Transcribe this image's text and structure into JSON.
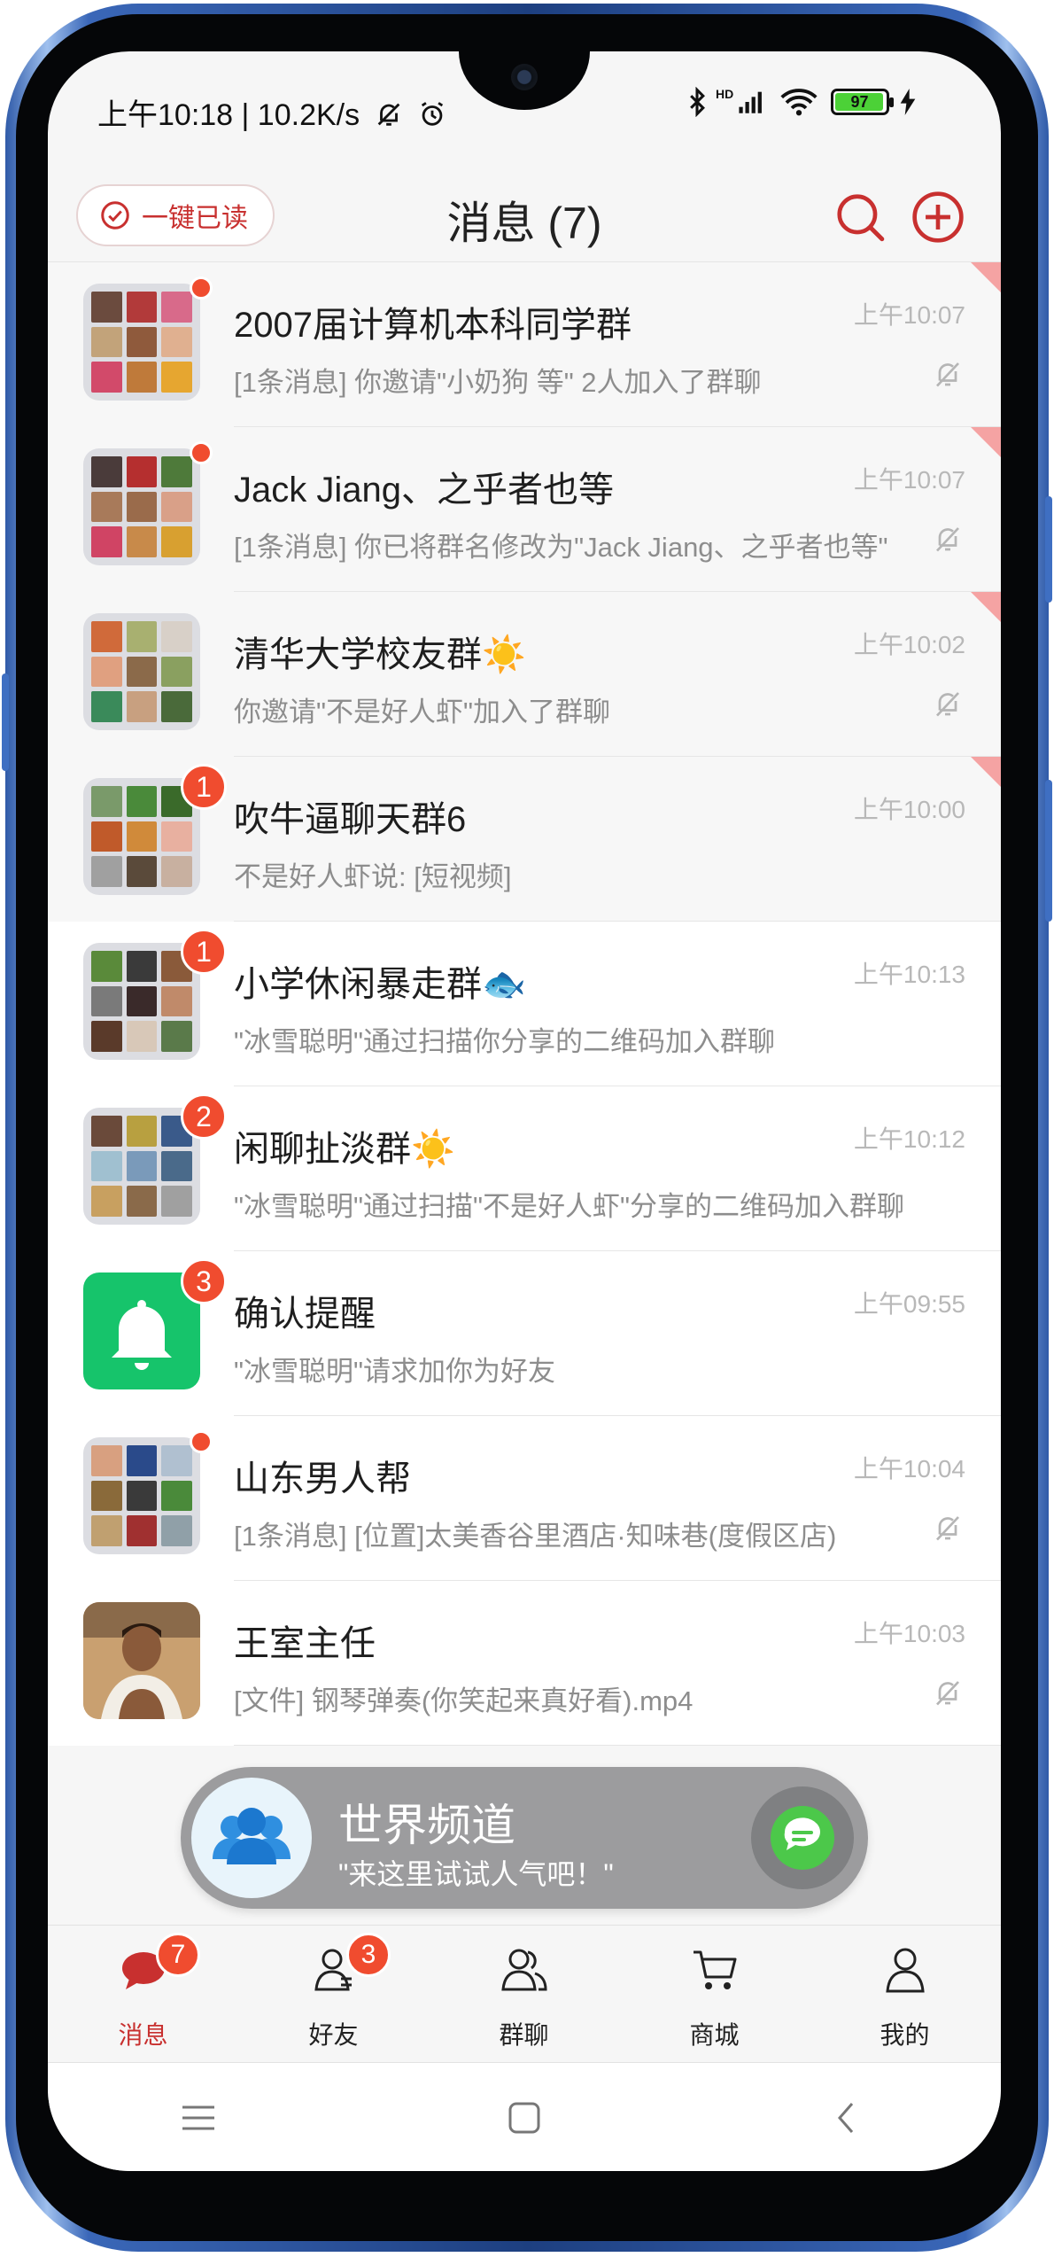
{
  "status_bar": {
    "time_text": "上午10:18 | 10.2K/s",
    "battery_level": 97,
    "battery_text": "97",
    "hd_text": "HD"
  },
  "header": {
    "mark_all_read": "一键已读",
    "title": "消息 (7)"
  },
  "conversations": [
    {
      "name": "2007届计算机本科同学群",
      "time": "上午10:07",
      "preview": "[1条消息] 你邀请\"小奶狗 等\" 2人加入了群聊",
      "pinned": true,
      "muted": true,
      "indicator": "dot",
      "badge": "",
      "avatar": "group"
    },
    {
      "name": "Jack Jiang、之乎者也等",
      "time": "上午10:07",
      "preview": "[1条消息] 你已将群名修改为\"Jack Jiang、之乎者也等\"",
      "pinned": true,
      "muted": true,
      "indicator": "dot",
      "badge": "",
      "avatar": "group"
    },
    {
      "name": "清华大学校友群☀️",
      "time": "上午10:02",
      "preview": "你邀请\"不是好人虾\"加入了群聊",
      "pinned": true,
      "muted": true,
      "indicator": "none",
      "badge": "",
      "avatar": "group"
    },
    {
      "name": "吹牛逼聊天群6",
      "time": "上午10:00",
      "preview": "不是好人虾说: [短视频]",
      "pinned": true,
      "muted": false,
      "indicator": "badge",
      "badge": "1",
      "avatar": "group"
    },
    {
      "name": "小学休闲暴走群🐟",
      "time": "上午10:13",
      "preview": "\"冰雪聪明\"通过扫描你分享的二维码加入群聊",
      "pinned": false,
      "muted": false,
      "indicator": "badge",
      "badge": "1",
      "avatar": "group"
    },
    {
      "name": "闲聊扯淡群☀️",
      "time": "上午10:12",
      "preview": "\"冰雪聪明\"通过扫描\"不是好人虾\"分享的二维码加入群聊",
      "pinned": false,
      "muted": false,
      "indicator": "badge",
      "badge": "2",
      "avatar": "group"
    },
    {
      "name": "确认提醒",
      "time": "上午09:55",
      "preview": "\"冰雪聪明\"请求加你为好友",
      "pinned": false,
      "muted": false,
      "indicator": "badge",
      "badge": "3",
      "avatar": "bell"
    },
    {
      "name": "山东男人帮",
      "time": "上午10:04",
      "preview": "[1条消息] [位置]太美香谷里酒店·知味巷(度假区店)",
      "pinned": false,
      "muted": true,
      "indicator": "dot",
      "badge": "",
      "avatar": "group"
    },
    {
      "name": "王室主任",
      "time": "上午10:03",
      "preview": "[文件] 钢琴弹奏(你笑起来真好看).mp4",
      "pinned": false,
      "muted": true,
      "indicator": "none",
      "badge": "",
      "avatar": "photo"
    }
  ],
  "world_channel": {
    "title": "世界频道",
    "subtitle": "\"来这里试试人气吧！\""
  },
  "tabs": [
    {
      "label": "消息",
      "icon": "chat-bubble-icon",
      "badge": "7",
      "active": true
    },
    {
      "label": "好友",
      "icon": "friends-icon",
      "badge": "3",
      "active": false
    },
    {
      "label": "群聊",
      "icon": "group-chat-icon",
      "badge": "",
      "active": false
    },
    {
      "label": "商城",
      "icon": "cart-icon",
      "badge": "",
      "active": false
    },
    {
      "label": "我的",
      "icon": "profile-icon",
      "badge": "",
      "active": false
    }
  ],
  "colors": {
    "accent": "#c8302f",
    "badge": "#f04c2f",
    "pinned_corner": "#f5a3a3",
    "bell_avatar": "#16c46b",
    "world_bar": "#9c9c9e",
    "frame_blue": "#2f5aa8"
  }
}
